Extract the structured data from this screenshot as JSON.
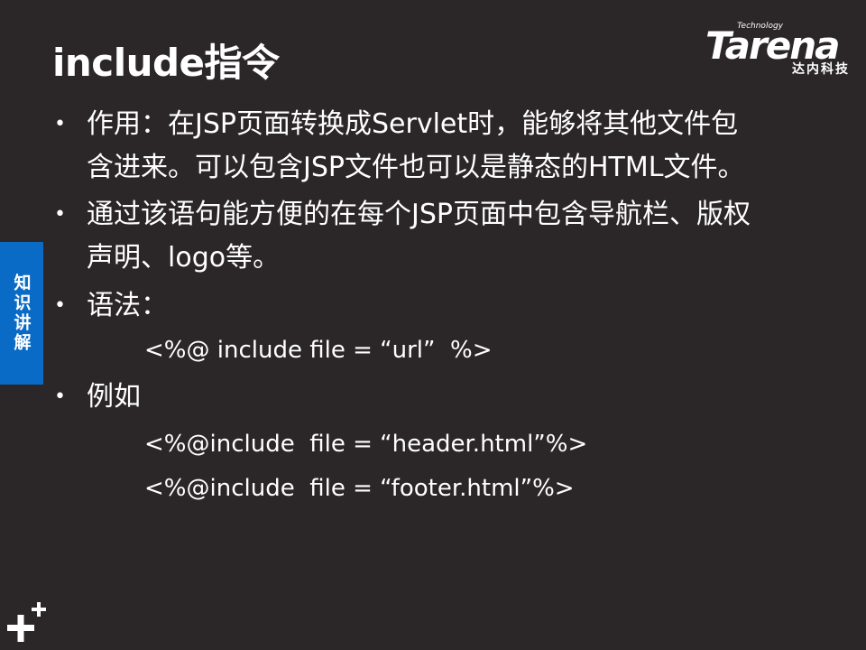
{
  "slide": {
    "title": "include指令",
    "side_tab": "知识讲解",
    "logo": {
      "tech": "Technology",
      "word": "Tarena",
      "cn": "达内科技"
    },
    "bullets": [
      {
        "lines": [
          "作用：在JSP页面转换成Servlet时，能够将其他文件包",
          "含进来。可以包含JSP文件也可以是静态的HTML文件。"
        ]
      },
      {
        "lines": [
          "通过该语句能方便的在每个JSP页面中包含导航栏、版权",
          "声明、logo等。"
        ]
      },
      {
        "lines": [
          "语法："
        ],
        "code": [
          "<%@ include file = “url”  %>"
        ]
      },
      {
        "lines": [
          "例如"
        ],
        "code": [
          "<%@include  file = “header.html”%>",
          "<%@include  file = “footer.html”%>"
        ]
      }
    ]
  },
  "icons": {
    "bullet": "bullet-dot-icon",
    "corner": "plus-icon"
  }
}
